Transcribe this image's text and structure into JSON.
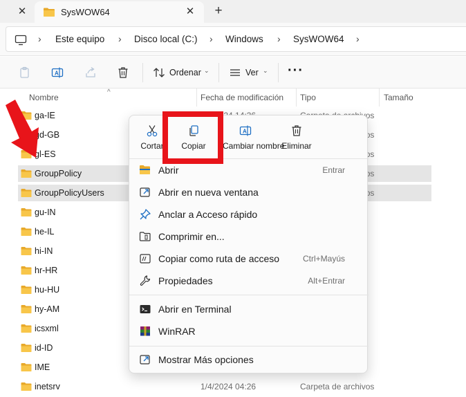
{
  "tabbar": {
    "tab_title": "SysWOW64",
    "close_glyph": "✕",
    "new_tab_glyph": "+"
  },
  "breadcrumb": [
    "Este equipo",
    "Disco local (C:)",
    "Windows",
    "SysWOW64"
  ],
  "breadcrumb_separator": "›",
  "toolbar": {
    "sort_label": "Ordenar",
    "view_label": "Ver",
    "more_glyph": "···"
  },
  "columns": {
    "name": "Nombre",
    "date": "Fecha de modificación",
    "type": "Tipo",
    "size": "Tamaño"
  },
  "files": [
    {
      "name": "ga-IE",
      "date": "1/4/2024 14:36",
      "type": "Carpeta de archivos",
      "selected": false
    },
    {
      "name": "gd-GB",
      "date": "",
      "type": "Carpeta de archivos",
      "selected": false
    },
    {
      "name": "gl-ES",
      "date": "",
      "type": "Carpeta de archivos",
      "selected": false
    },
    {
      "name": "GroupPolicy",
      "date": "",
      "type": "Carpeta de archivos",
      "selected": true
    },
    {
      "name": "GroupPolicyUsers",
      "date": "",
      "type": "Carpeta de archivos",
      "selected": true
    },
    {
      "name": "gu-IN",
      "date": "",
      "type": "",
      "selected": false
    },
    {
      "name": "he-IL",
      "date": "",
      "type": "",
      "selected": false
    },
    {
      "name": "hi-IN",
      "date": "",
      "type": "",
      "selected": false
    },
    {
      "name": "hr-HR",
      "date": "",
      "type": "",
      "selected": false
    },
    {
      "name": "hu-HU",
      "date": "",
      "type": "",
      "selected": false
    },
    {
      "name": "hy-AM",
      "date": "",
      "type": "",
      "selected": false
    },
    {
      "name": "icsxml",
      "date": "",
      "type": "",
      "selected": false
    },
    {
      "name": "id-ID",
      "date": "",
      "type": "",
      "selected": false
    },
    {
      "name": "IME",
      "date": "",
      "type": "",
      "selected": false
    },
    {
      "name": "inetsrv",
      "date": "1/4/2024 04:26",
      "type": "Carpeta de archivos",
      "selected": false
    }
  ],
  "context_menu": {
    "actions": [
      {
        "label": "Cortar",
        "icon": "scissors-icon"
      },
      {
        "label": "Copiar",
        "icon": "copy-icon"
      },
      {
        "label": "Cambiar nombre",
        "icon": "rename-icon"
      },
      {
        "label": "Eliminar",
        "icon": "trash-icon"
      }
    ],
    "items": [
      {
        "label": "Abrir",
        "shortcut": "Entrar",
        "icon": "folder-open-icon"
      },
      {
        "label": "Abrir en nueva ventana",
        "shortcut": "",
        "icon": "new-window-icon"
      },
      {
        "label": "Anclar a Acceso rápido",
        "shortcut": "",
        "icon": "pin-icon"
      },
      {
        "label": "Comprimir en...",
        "shortcut": "",
        "icon": "compress-icon"
      },
      {
        "label": "Copiar como ruta de acceso",
        "shortcut": "Ctrl+Mayús",
        "icon": "copy-path-icon"
      },
      {
        "label": "Propiedades",
        "shortcut": "Alt+Entrar",
        "icon": "wrench-icon"
      },
      {
        "label": "Abrir en Terminal",
        "shortcut": "",
        "icon": "terminal-icon"
      },
      {
        "label": "WinRAR",
        "shortcut": "",
        "icon": "winrar-icon"
      },
      {
        "label": "Mostrar Más opciones",
        "shortcut": "",
        "icon": "more-options-icon"
      }
    ]
  },
  "colors": {
    "folder": "#f8c64a",
    "folder_dark": "#e8a92a",
    "highlight_red": "#e8141a",
    "accent_blue": "#1e6fc4",
    "selection": "#e5e5e5"
  }
}
